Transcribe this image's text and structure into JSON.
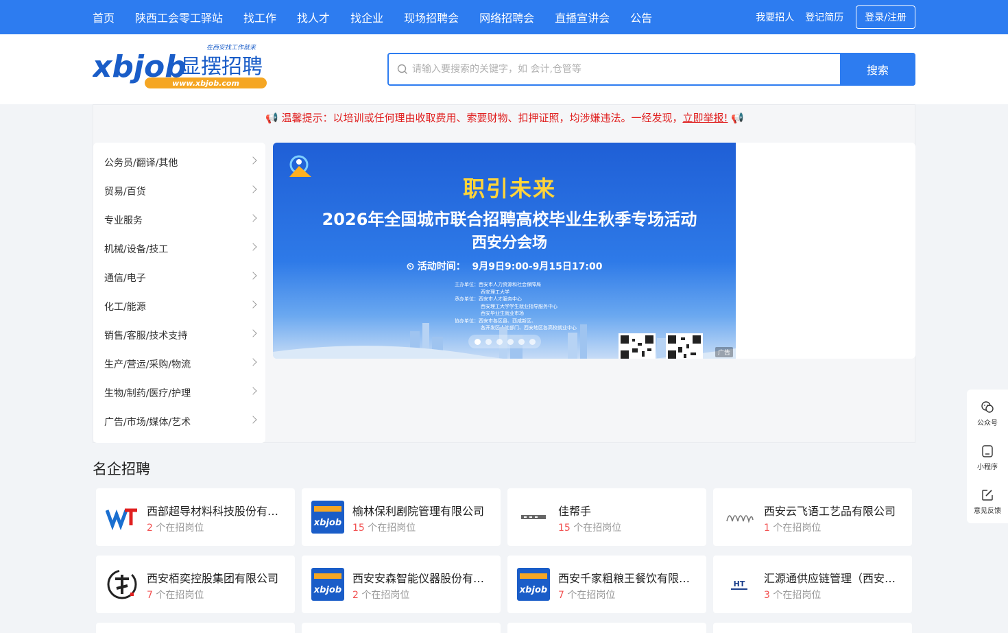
{
  "topnav": {
    "items": [
      "首页",
      "陕西工会零工驿站",
      "找工作",
      "找人才",
      "找企业",
      "现场招聘会",
      "网络招聘会",
      "直播宣讲会",
      "公告"
    ],
    "post_job": "我要招人",
    "register_resume": "登记简历",
    "login": "登录/注册"
  },
  "logo": {
    "main": "xbjob",
    "cn": "显摆招聘",
    "slogan": "在西安找工作就来",
    "url": "www.xbjob.com"
  },
  "search": {
    "placeholder": "请输入要搜索的关键字，如 会计,仓管等",
    "button": "搜索"
  },
  "notice": {
    "text": "📢 温馨提示：以培训或任何理由收取费用、索要财物、扣押证照，均涉嫌违法。一经发现，",
    "link": "立即举报!",
    "end": " 📢"
  },
  "categories": [
    "公务员/翻译/其他",
    "贸易/百货",
    "专业服务",
    "机械/设备/技工",
    "通信/电子",
    "化工/能源",
    "销售/客服/技术支持",
    "生产/营运/采购/物流",
    "生物/制药/医疗/护理",
    "广告/市场/媒体/艺术"
  ],
  "banner": {
    "headline": "职引未来",
    "title": "2026年全国城市联合招聘高校毕业生秋季专场活动",
    "subtitle": "西安分会场",
    "time_label": "活动时间：",
    "time": "9月9日9:00-9月15日17:00",
    "org_lines": [
      "主办单位：西安市人力资源和社会保障局",
      "西安理工大学",
      "承办单位：西安市人才服务中心",
      "西安理工大学学生就业指导服务中心",
      "西安毕业生就业市场",
      "协办单位：西安市各区县、西咸新区、",
      "各开发区人社部门、西安地区各高校就业中心"
    ],
    "ad_label": "广告",
    "slide_count": 6,
    "active_slide": 1
  },
  "section": {
    "title": "名企招聘",
    "jobs_suffix": " 个在招岗位"
  },
  "companies": [
    {
      "name": "西部超导材料科技股份有限公司",
      "count": "2",
      "logo": "wst-logo"
    },
    {
      "name": "榆林保利剧院管理有限公司",
      "count": "15",
      "logo": "xbjob-logo"
    },
    {
      "name": "佳帮手",
      "count": "15",
      "logo": "jiabangshou-logo"
    },
    {
      "name": "西安云飞语工艺品有限公司",
      "count": "1",
      "logo": "yunfeiyu-logo"
    },
    {
      "name": "西安栢奕控股集团有限公司",
      "count": "7",
      "logo": "baiyi-logo"
    },
    {
      "name": "西安安森智能仪器股份有限公司",
      "count": "2",
      "logo": "xbjob-logo"
    },
    {
      "name": "西安千家粗粮王餐饮有限公司",
      "count": "7",
      "logo": "xbjob-logo"
    },
    {
      "name": "汇源通供应链管理（西安）有限公司",
      "count": "3",
      "logo": "ht-logo"
    }
  ],
  "float": {
    "wechat": "公众号",
    "miniapp": "小程序",
    "feedback": "意见反馈"
  },
  "colors": {
    "primary": "#2d7cf0",
    "warning": "#e02020",
    "count": "#f25050"
  }
}
